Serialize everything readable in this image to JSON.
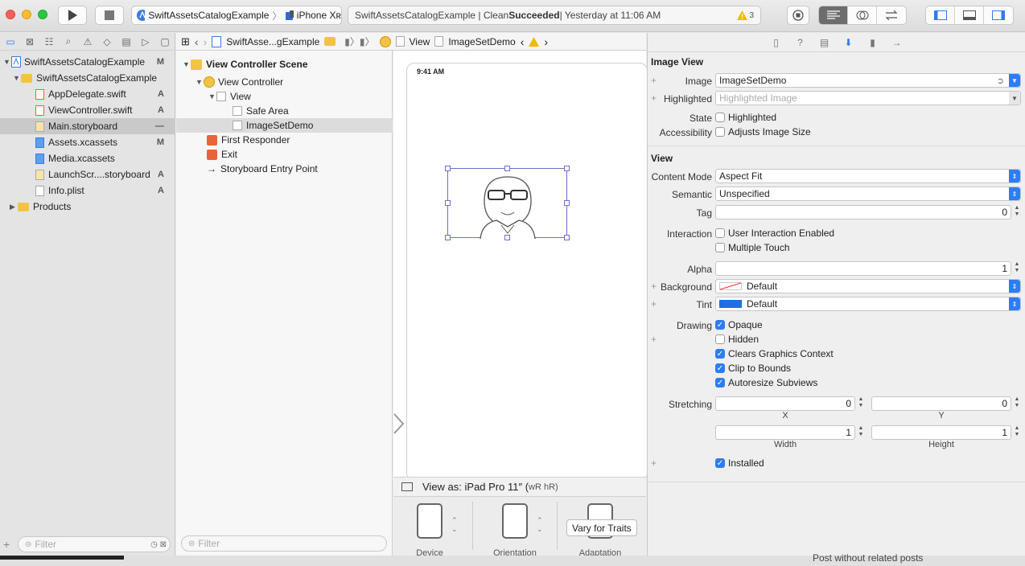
{
  "toolbar": {
    "scheme_target": "SwiftAssetsCatalogExample",
    "device": "iPhone Xʀ",
    "status_prefix": "SwiftAssetsCatalogExample | Clean ",
    "status_bold": "Succeeded",
    "status_suffix": " | Yesterday at 11:06 AM",
    "warning_count": "3"
  },
  "navigator": {
    "items": [
      {
        "label": "SwiftAssetsCatalogExample",
        "badge": "M"
      },
      {
        "label": "SwiftAssetsCatalogExample",
        "badge": ""
      },
      {
        "label": "AppDelegate.swift",
        "badge": "A"
      },
      {
        "label": "ViewController.swift",
        "badge": "A"
      },
      {
        "label": "Main.storyboard",
        "badge": "—"
      },
      {
        "label": "Assets.xcassets",
        "badge": "M"
      },
      {
        "label": "Media.xcassets",
        "badge": ""
      },
      {
        "label": "LaunchScr....storyboard",
        "badge": "A"
      },
      {
        "label": "Info.plist",
        "badge": "A"
      },
      {
        "label": "Products",
        "badge": ""
      }
    ],
    "filter_placeholder": "Filter"
  },
  "jumpbar": {
    "crumbs": [
      "SwiftAsse...gExample",
      "View",
      "ImageSetDemo"
    ]
  },
  "outline": {
    "items": [
      "View Controller Scene",
      "View Controller",
      "View",
      "Safe Area",
      "ImageSetDemo",
      "First Responder",
      "Exit",
      "Storyboard Entry Point"
    ],
    "filter_placeholder": "Filter"
  },
  "canvas": {
    "time": "9:41 AM",
    "view_as": "View as: iPad Pro 11″ (",
    "view_as_traits": "wR hR)",
    "traits": [
      "Device",
      "Orientation",
      "Adaptation"
    ],
    "vary_button": "Vary for Traits"
  },
  "inspector": {
    "image_view": {
      "title": "Image View",
      "image_label": "Image",
      "image_value": "ImageSetDemo",
      "highlighted_label": "Highlighted",
      "highlighted_placeholder": "Highlighted Image",
      "state_label": "State",
      "state_option": "Highlighted",
      "accessibility_label": "Accessibility",
      "accessibility_option": "Adjusts Image Size"
    },
    "view": {
      "title": "View",
      "content_mode_label": "Content Mode",
      "content_mode_value": "Aspect Fit",
      "semantic_label": "Semantic",
      "semantic_value": "Unspecified",
      "tag_label": "Tag",
      "tag_value": "0",
      "interaction_label": "Interaction",
      "user_interaction": "User Interaction Enabled",
      "multiple_touch": "Multiple Touch",
      "alpha_label": "Alpha",
      "alpha_value": "1",
      "background_label": "Background",
      "background_value": "Default",
      "tint_label": "Tint",
      "tint_value": "Default",
      "drawing_label": "Drawing",
      "opaque": "Opaque",
      "hidden": "Hidden",
      "clears": "Clears Graphics Context",
      "clip": "Clip to Bounds",
      "autoresize": "Autoresize Subviews",
      "stretching_label": "Stretching",
      "x_value": "0",
      "y_value": "0",
      "width_value": "1",
      "height_value": "1",
      "x_lbl": "X",
      "y_lbl": "Y",
      "width_lbl": "Width",
      "height_lbl": "Height",
      "installed": "Installed"
    }
  },
  "colors": {
    "accent": "#2e7cf6",
    "tint": "#1f6fe0"
  },
  "background_peek": "Post without related posts"
}
